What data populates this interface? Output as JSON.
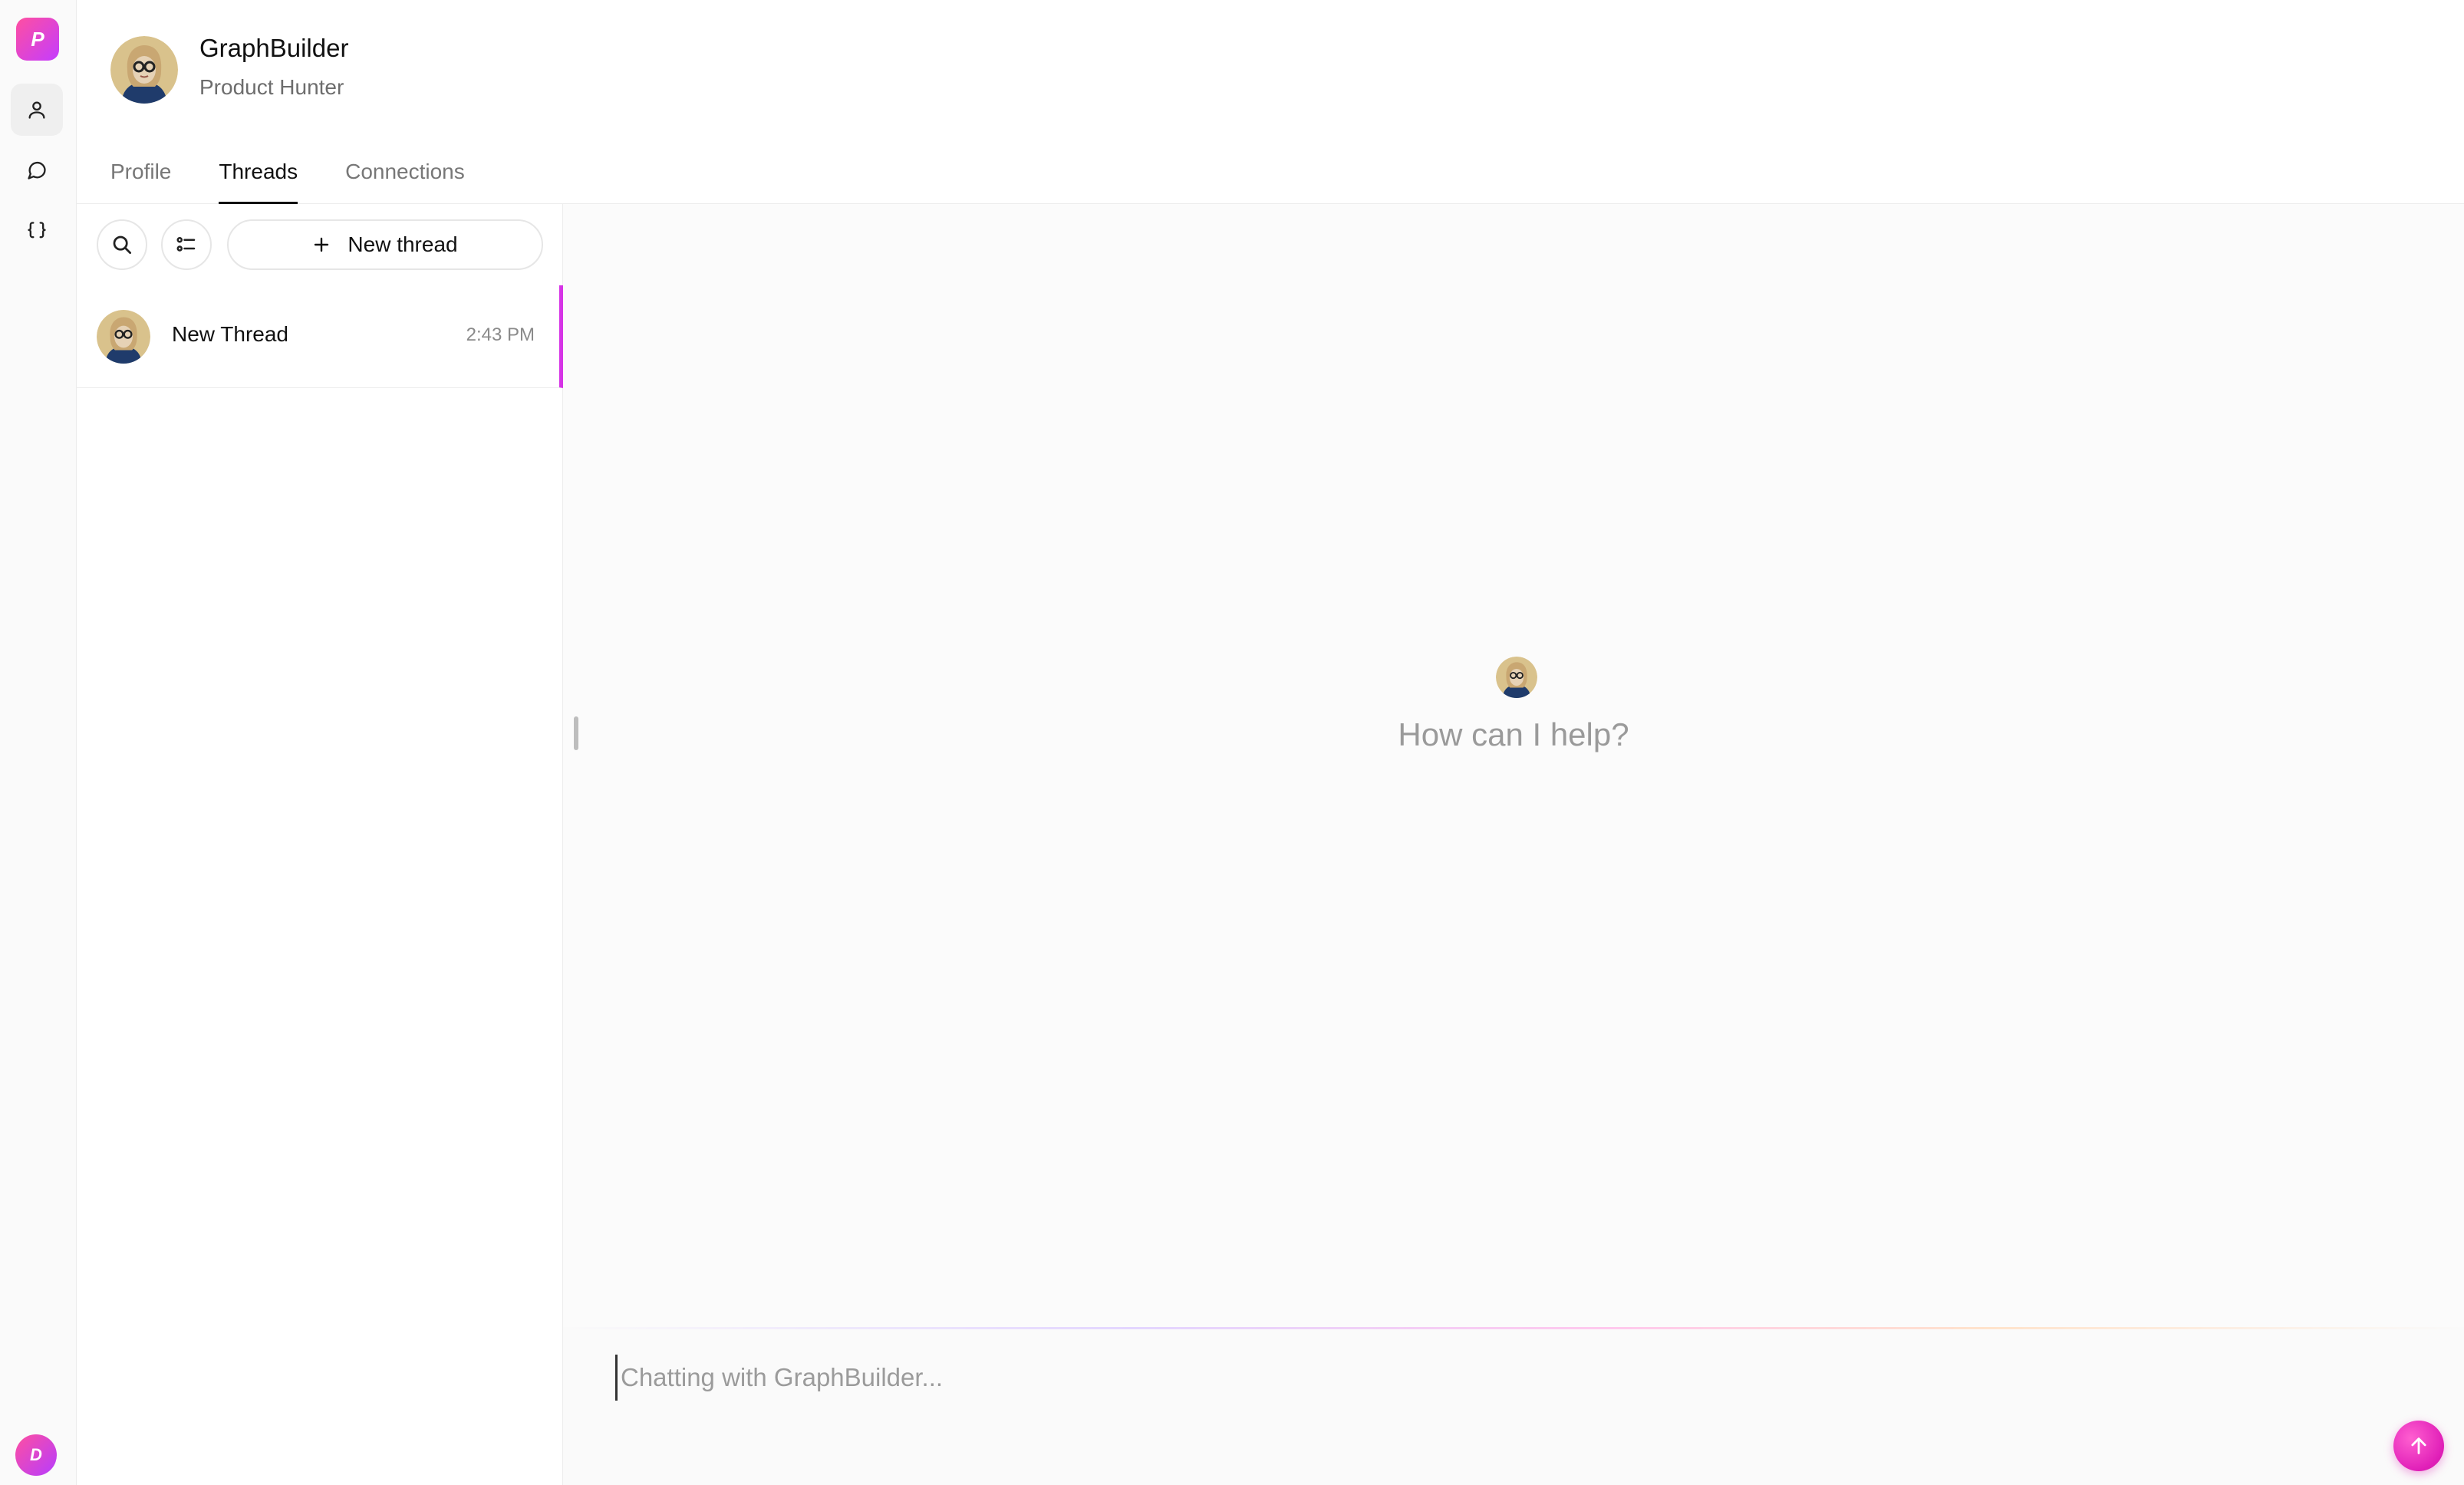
{
  "rail": {
    "logo_letter": "P",
    "user_initial": "D",
    "items": [
      "user-icon",
      "chat-bubble-icon",
      "braces-icon"
    ]
  },
  "agent": {
    "name": "GraphBuilder",
    "subtitle": "Product Hunter"
  },
  "tabs": [
    {
      "label": "Profile",
      "active": false
    },
    {
      "label": "Threads",
      "active": true
    },
    {
      "label": "Connections",
      "active": false
    }
  ],
  "thread_list": {
    "new_thread_label": "New thread",
    "items": [
      {
        "title": "New Thread",
        "time": "2:43 PM",
        "selected": true
      }
    ]
  },
  "chat": {
    "empty_prompt": "How can I help?",
    "input_placeholder": "Chatting with GraphBuilder...",
    "input_value": ""
  },
  "colors": {
    "accent": "#d633e6",
    "send_button": "#e01fb8",
    "brand_gradient_start": "#ff4fa0",
    "brand_gradient_end": "#c43cff"
  }
}
